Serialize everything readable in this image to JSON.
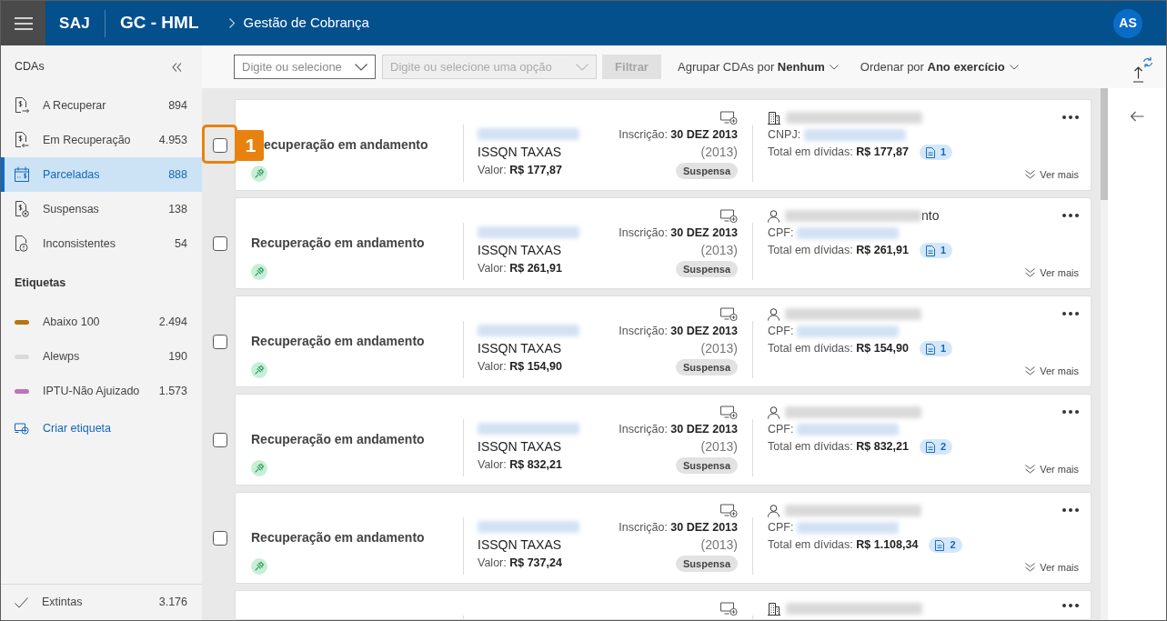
{
  "header": {
    "app": "SAJ",
    "module": "GC - HML",
    "breadcrumb": "Gestão de Cobrança",
    "avatar": "AS"
  },
  "sidebar": {
    "title": "CDAs",
    "items": [
      {
        "label": "A Recuperar",
        "count": "894",
        "selected": false
      },
      {
        "label": "Em Recuperação",
        "count": "4.953",
        "selected": false
      },
      {
        "label": "Parceladas",
        "count": "888",
        "selected": true
      },
      {
        "label": "Suspensas",
        "count": "138",
        "selected": false
      },
      {
        "label": "Inconsistentes",
        "count": "54",
        "selected": false
      }
    ],
    "tags_title": "Etiquetas",
    "tags": [
      {
        "label": "Abaixo 100",
        "count": "2.494",
        "color": "#b5760f"
      },
      {
        "label": "Alewps",
        "count": "190",
        "color": "#d9d9d9"
      },
      {
        "label": "IPTU-Não Ajuizado",
        "count": "1.573",
        "color": "#c270b6"
      }
    ],
    "create_tag": "Criar etiqueta",
    "footer_item": {
      "label": "Extintas",
      "count": "3.176",
      "selected": false
    }
  },
  "toolbar": {
    "filters": [
      {
        "placeholder": "Digite ou selecione",
        "disabled": false
      },
      {
        "placeholder": "Digite ou selecione uma opção",
        "disabled": true
      }
    ],
    "filter_button": {
      "label": "Filtrar",
      "disabled": true
    },
    "group_by": "Agrupar CDAs por **Nenhum**",
    "sort_by": "Ordenar por **Ano exercício**"
  },
  "cards": [
    {
      "kind": "company",
      "title": "ecuperação em andamento",
      "callout": "1",
      "checked": false,
      "tax": "ISSQN TAXAS",
      "value": "Valor: **R$ 177,87**",
      "inscription": "Inscrição: **30 DEZ 2013**",
      "year": "(2013)",
      "status": "Suspensa",
      "doc_label": "CNPJ:",
      "total": "Total em dívidas: **R$ 177,87**",
      "documents": "1",
      "more": "Ver mais"
    },
    {
      "kind": "person",
      "title": "Recuperação em andamento",
      "checked": false,
      "tax": "ISSQN TAXAS",
      "value": "Valor: **R$ 261,91**",
      "inscription": "Inscrição: **30 DEZ 2013**",
      "year": "(2013)",
      "status": "Suspensa",
      "name_tail": "nto",
      "doc_label": "CPF:",
      "total": "Total em dívidas: **R$ 261,91**",
      "documents": "1",
      "more": "Ver mais"
    },
    {
      "kind": "person",
      "title": "Recuperação em andamento",
      "checked": false,
      "tax": "ISSQN TAXAS",
      "value": "Valor: **R$ 154,90**",
      "inscription": "Inscrição: **30 DEZ 2013**",
      "year": "(2013)",
      "status": "Suspensa",
      "doc_label": "CPF:",
      "total": "Total em dívidas: **R$ 154,90**",
      "documents": "1",
      "more": "Ver mais"
    },
    {
      "kind": "person",
      "title": "Recuperação em andamento",
      "checked": false,
      "tax": "ISSQN TAXAS",
      "value": "Valor: **R$ 832,21**",
      "inscription": "Inscrição: **30 DEZ 2013**",
      "year": "(2013)",
      "status": "Suspensa",
      "doc_label": "CPF:",
      "total": "Total em dívidas: **R$ 832,21**",
      "documents": "2",
      "more": "Ver mais"
    },
    {
      "kind": "person",
      "title": "Recuperação em andamento",
      "checked": false,
      "tax": "ISSQN TAXAS",
      "value": "Valor: **R$ 737,24**",
      "inscription": "Inscrição: **30 DEZ 2013**",
      "year": "(2013)",
      "status": "Suspensa",
      "doc_label": "CPF:",
      "total": "Total em dívidas: **R$ 1.108,34**",
      "documents": "2",
      "more": "Ver mais"
    },
    {
      "kind": "company"
    }
  ]
}
